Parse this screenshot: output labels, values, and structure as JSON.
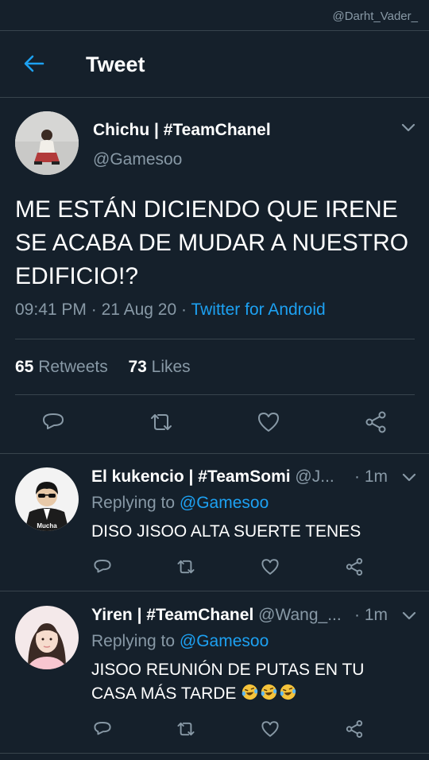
{
  "watermark": "@Darht_Vader_",
  "header": {
    "title": "Tweet"
  },
  "tweet": {
    "author_name": "Chichu | #TeamChanel",
    "author_handle": "@Gamesoo",
    "text": "ME ESTÁN DICIENDO QUE IRENE SE ACABA DE MUDAR A NUESTRO EDIFICIO!?",
    "time": "09:41 PM",
    "date": "21 Aug 20",
    "source": "Twitter for Android",
    "retweets_count": "65",
    "retweets_label": "Retweets",
    "likes_count": "73",
    "likes_label": "Likes"
  },
  "replies": [
    {
      "name": "El kukencio | #TeamSomi",
      "handle": "@J...",
      "time": "1m",
      "replying_label": "Replying to",
      "replying_to": "@Gamesoo",
      "text": "DISO JISOO ALTA SUERTE TENES",
      "avatar_caption": "Mucha"
    },
    {
      "name": "Yiren | #TeamChanel",
      "handle": "@Wang_...",
      "time": "1m",
      "replying_label": "Replying to",
      "replying_to": "@Gamesoo",
      "text": "JISOO REUNIÓN DE PUTAS EN TU CASA MÁS TARDE"
    }
  ],
  "colors": {
    "background": "#15202b",
    "divider": "#38444d",
    "accent": "#1da1f2",
    "secondary_text": "#8899a6"
  },
  "icons": [
    "back-arrow-icon",
    "chevron-down-icon",
    "reply-icon",
    "retweet-icon",
    "like-icon",
    "share-icon",
    "laughing-emoji-icon"
  ]
}
